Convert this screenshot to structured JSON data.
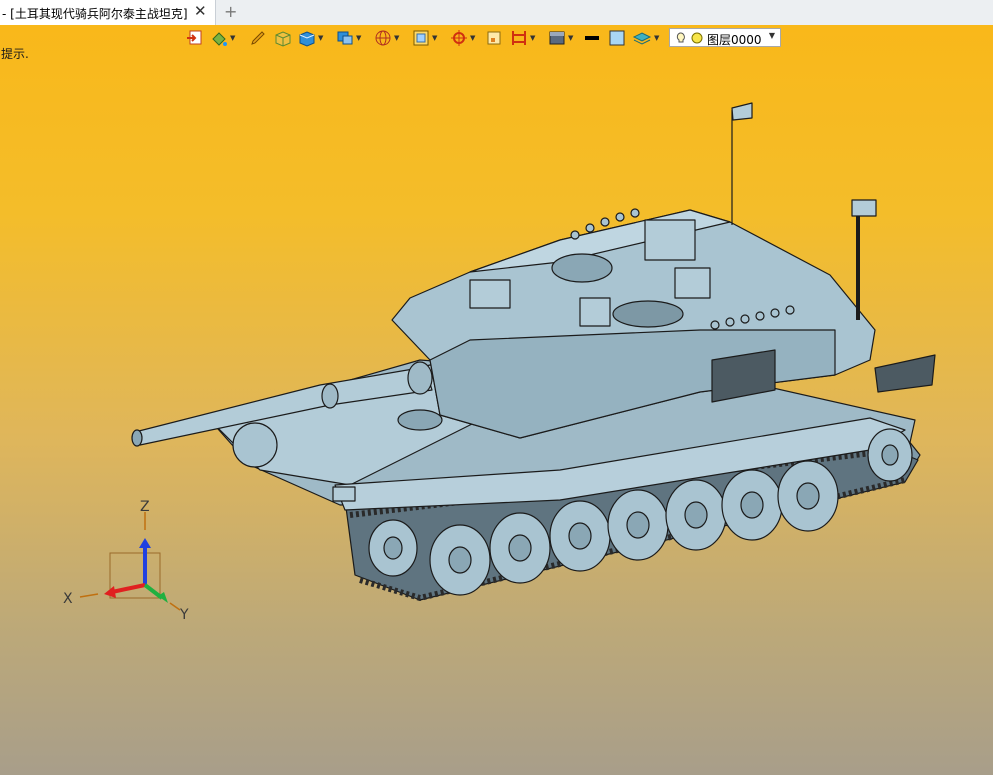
{
  "tab": {
    "title": "- [土耳其现代骑兵阿尔泰主战坦克]",
    "close_glyph": "✕",
    "new_tab_glyph": "+"
  },
  "hint": "提示.",
  "toolbar": {
    "icons": [
      "import-icon",
      "paint-bucket-icon",
      "pen-icon",
      "box-color-icon",
      "cube-view-icon",
      "display-mode-icon",
      "sphere-wire-icon",
      "frame-view-icon",
      "target-icon",
      "square-icon",
      "section-icon",
      "render-icon",
      "line-weight-icon",
      "color-swatch-icon",
      "layer-stack-icon"
    ],
    "layer": {
      "value": "图层0000",
      "arrow": "▼"
    }
  },
  "axes": {
    "x": "X",
    "y": "Y",
    "z": "Z"
  },
  "colors": {
    "model": "#a9c4d1",
    "model_dark": "#8aa7b5",
    "outline": "#1b1b1b",
    "axis_x": "#e02020",
    "axis_y": "#20b040",
    "axis_z": "#2040e0",
    "background_top": "#f9b81a"
  }
}
